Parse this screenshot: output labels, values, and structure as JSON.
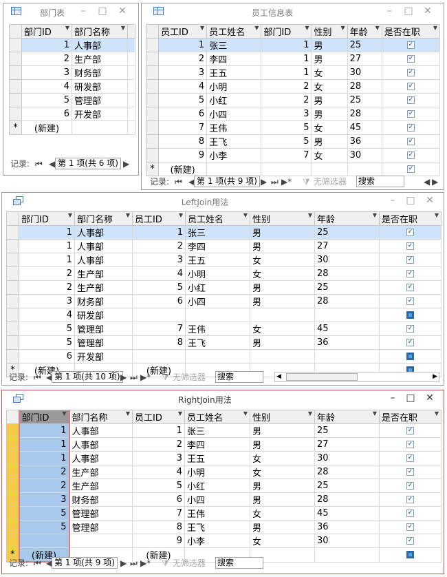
{
  "dept": {
    "title": "部门表",
    "columns": [
      "部门ID",
      "部门名称"
    ],
    "rows": [
      {
        "id": "1",
        "name": "人事部"
      },
      {
        "id": "2",
        "name": "生产部"
      },
      {
        "id": "3",
        "name": "财务部"
      },
      {
        "id": "4",
        "name": "研发部"
      },
      {
        "id": "5",
        "name": "管理部"
      },
      {
        "id": "6",
        "name": "开发部"
      }
    ],
    "new_label": "(新建)",
    "record_label": "记录:",
    "page_text": "第 1 项(共 6 项)"
  },
  "emp": {
    "title": "员工信息表",
    "columns": [
      "员工ID",
      "员工姓名",
      "部门ID",
      "性别",
      "年龄",
      "是否在职"
    ],
    "rows": [
      {
        "eid": "1",
        "name": "张三",
        "did": "1",
        "sex": "男",
        "age": "25"
      },
      {
        "eid": "2",
        "name": "李四",
        "did": "1",
        "sex": "男",
        "age": "27"
      },
      {
        "eid": "3",
        "name": "王五",
        "did": "1",
        "sex": "女",
        "age": "30"
      },
      {
        "eid": "4",
        "name": "小明",
        "did": "2",
        "sex": "女",
        "age": "28"
      },
      {
        "eid": "5",
        "name": "小红",
        "did": "2",
        "sex": "男",
        "age": "25"
      },
      {
        "eid": "6",
        "name": "小四",
        "did": "3",
        "sex": "男",
        "age": "28"
      },
      {
        "eid": "7",
        "name": "王伟",
        "did": "5",
        "sex": "女",
        "age": "45"
      },
      {
        "eid": "8",
        "name": "王飞",
        "did": "5",
        "sex": "男",
        "age": "36"
      },
      {
        "eid": "9",
        "name": "小李",
        "did": "7",
        "sex": "女",
        "age": "30"
      }
    ],
    "new_label": "(新建)",
    "record_label": "记录:",
    "page_text": "第 1 项(共 9 项)",
    "filter_label": "无筛选器",
    "search_label": "搜索"
  },
  "left": {
    "title": "LeftJoin用法",
    "columns": [
      "部门ID",
      "部门名称",
      "员工ID",
      "员工姓名",
      "性别",
      "年龄",
      "是否在职"
    ],
    "rows": [
      {
        "did": "1",
        "dname": "人事部",
        "eid": "1",
        "ename": "张三",
        "sex": "男",
        "age": "25"
      },
      {
        "did": "1",
        "dname": "人事部",
        "eid": "2",
        "ename": "李四",
        "sex": "男",
        "age": "27"
      },
      {
        "did": "1",
        "dname": "人事部",
        "eid": "3",
        "ename": "王五",
        "sex": "女",
        "age": "30"
      },
      {
        "did": "2",
        "dname": "生产部",
        "eid": "4",
        "ename": "小明",
        "sex": "女",
        "age": "28"
      },
      {
        "did": "2",
        "dname": "生产部",
        "eid": "5",
        "ename": "小红",
        "sex": "男",
        "age": "25"
      },
      {
        "did": "3",
        "dname": "财务部",
        "eid": "6",
        "ename": "小四",
        "sex": "男",
        "age": "28"
      },
      {
        "did": "4",
        "dname": "研发部",
        "eid": "",
        "ename": "",
        "sex": "",
        "age": ""
      },
      {
        "did": "5",
        "dname": "管理部",
        "eid": "7",
        "ename": "王伟",
        "sex": "女",
        "age": "45"
      },
      {
        "did": "5",
        "dname": "管理部",
        "eid": "8",
        "ename": "王飞",
        "sex": "男",
        "age": "36"
      },
      {
        "did": "6",
        "dname": "开发部",
        "eid": "",
        "ename": "",
        "sex": "",
        "age": ""
      }
    ],
    "new_label": "(新建)",
    "record_label": "记录:",
    "page_text": "第 1 项(共 10 项)",
    "filter_label": "无筛选器",
    "search_label": "搜索"
  },
  "right": {
    "title": "RightJoin用法",
    "columns": [
      "部门ID",
      "部门名称",
      "员工ID",
      "员工姓名",
      "性别",
      "年龄",
      "是否在职"
    ],
    "rows": [
      {
        "did": "1",
        "dname": "人事部",
        "eid": "1",
        "ename": "张三",
        "sex": "男",
        "age": "25"
      },
      {
        "did": "1",
        "dname": "人事部",
        "eid": "2",
        "ename": "李四",
        "sex": "男",
        "age": "27"
      },
      {
        "did": "1",
        "dname": "人事部",
        "eid": "3",
        "ename": "王五",
        "sex": "女",
        "age": "30"
      },
      {
        "did": "2",
        "dname": "生产部",
        "eid": "4",
        "ename": "小明",
        "sex": "女",
        "age": "28"
      },
      {
        "did": "2",
        "dname": "生产部",
        "eid": "5",
        "ename": "小红",
        "sex": "男",
        "age": "25"
      },
      {
        "did": "3",
        "dname": "财务部",
        "eid": "6",
        "ename": "小四",
        "sex": "男",
        "age": "28"
      },
      {
        "did": "5",
        "dname": "管理部",
        "eid": "7",
        "ename": "王伟",
        "sex": "女",
        "age": "45"
      },
      {
        "did": "5",
        "dname": "管理部",
        "eid": "8",
        "ename": "王飞",
        "sex": "男",
        "age": "36"
      },
      {
        "did": "",
        "dname": "",
        "eid": "9",
        "ename": "小李",
        "sex": "女",
        "age": "30"
      }
    ],
    "new_label": "(新建)",
    "record_label": "记录:",
    "page_text": "第 1 项(共 9 项)",
    "filter_label": "无筛选器",
    "search_label": "搜索"
  }
}
